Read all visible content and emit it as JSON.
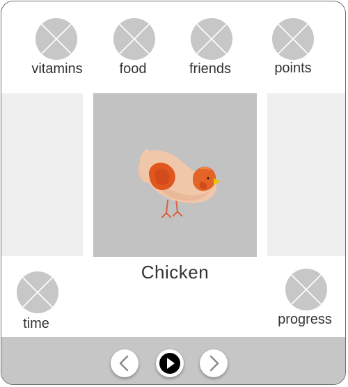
{
  "stats_top": [
    {
      "label": "vitamins",
      "icon": "placeholder-icon"
    },
    {
      "label": "food",
      "icon": "placeholder-icon"
    },
    {
      "label": "friends",
      "icon": "placeholder-icon"
    },
    {
      "label": "points",
      "icon": "placeholder-icon"
    }
  ],
  "stats_bottom": {
    "time": {
      "label": "time",
      "icon": "placeholder-icon"
    },
    "progress": {
      "label": "progress",
      "icon": "placeholder-icon"
    }
  },
  "animal": {
    "name": "Chicken",
    "image": "chicken-illustration"
  },
  "controls": {
    "prev_icon": "chevron-left-icon",
    "play_icon": "play-icon",
    "next_icon": "chevron-right-icon"
  },
  "colors": {
    "placeholder": "#c7c7c7",
    "card_background": "#c2c2c2",
    "side_panel": "#efefef",
    "bottom_bar": "#c6c6c6",
    "chicken_body": "#f2c6a8",
    "chicken_wing": "#e0571e",
    "beak": "#f2c200"
  }
}
